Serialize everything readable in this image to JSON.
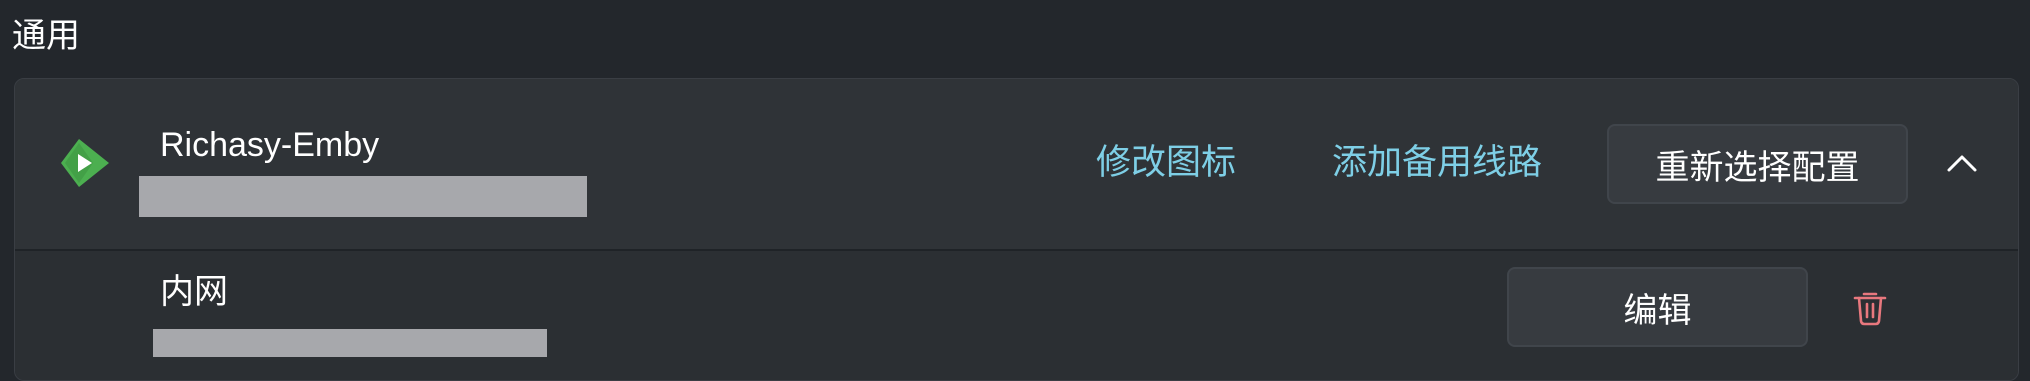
{
  "section": {
    "title": "通用"
  },
  "server": {
    "name": "Richasy-Emby",
    "icon": "emby-logo-icon",
    "actions": {
      "change_icon_label": "修改图标",
      "add_backup_route_label": "添加备用线路",
      "reselect_config_label": "重新选择配置",
      "collapse_icon": "chevron-up-icon"
    }
  },
  "route": {
    "name": "内网",
    "edit_label": "编辑",
    "delete_icon": "trash-icon"
  },
  "colors": {
    "background": "#23272c",
    "panel": "#2d3136",
    "link": "#7ecfe6",
    "danger": "#e8787e",
    "logo": "#4caf50"
  }
}
